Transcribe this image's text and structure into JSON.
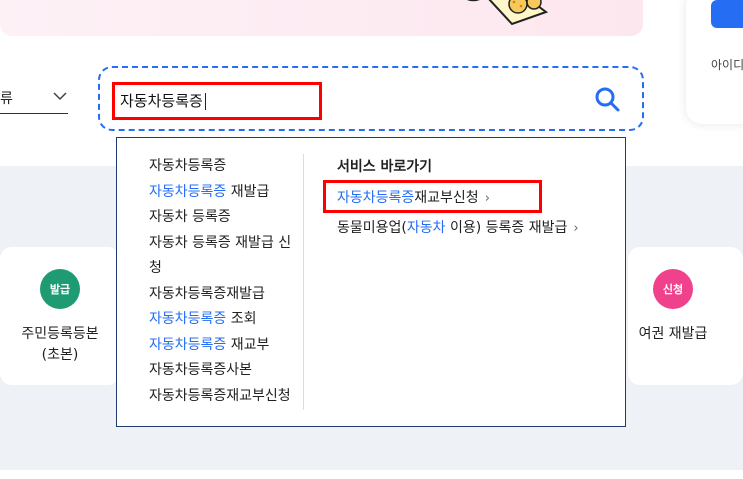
{
  "category": {
    "selected": "류"
  },
  "search": {
    "value": "자동차등록증"
  },
  "login": {
    "id_label": "아이디"
  },
  "dropdown": {
    "suggestions": [
      {
        "pre": "",
        "hl": "",
        "post": "자동차등록증"
      },
      {
        "pre": "",
        "hl": "자동차등록증",
        "post": " 재발급"
      },
      {
        "pre": "",
        "hl": "",
        "post": "자동차 등록증"
      },
      {
        "pre": "",
        "hl": "",
        "post": "자동차 등록증 재발급 신청"
      },
      {
        "pre": "",
        "hl": "",
        "post": "자동차등록증재발급"
      },
      {
        "pre": "",
        "hl": "자동차등록증",
        "post": " 조회"
      },
      {
        "pre": "",
        "hl": "자동차등록증",
        "post": " 재교부"
      },
      {
        "pre": "",
        "hl": "",
        "post": "자동차등록증사본"
      },
      {
        "pre": "",
        "hl": "",
        "post": "자동차등록증재교부신청"
      }
    ],
    "shortcut_title": "서비스 바로가기",
    "shortcuts": [
      {
        "pre": "",
        "hl": "자동차등록증",
        "post": "재교부신청",
        "arrow": "›"
      },
      {
        "pre": "동물미용업(",
        "hl": "자동차",
        "post": " 이용) 등록증 재발급",
        "arrow": "›"
      }
    ]
  },
  "services": [
    {
      "badge": "발급",
      "label_line1": "주민등록등본",
      "label_line2": "(초본)",
      "color": "#1e9b73"
    },
    {
      "badge": "신청",
      "label_line1": "여권 재발급",
      "label_line2": "",
      "color": "#f0418c"
    }
  ],
  "colors": {
    "accent": "#256ef4",
    "highlight_box": "#ff0000",
    "dropdown_border": "#1f3b6d"
  }
}
